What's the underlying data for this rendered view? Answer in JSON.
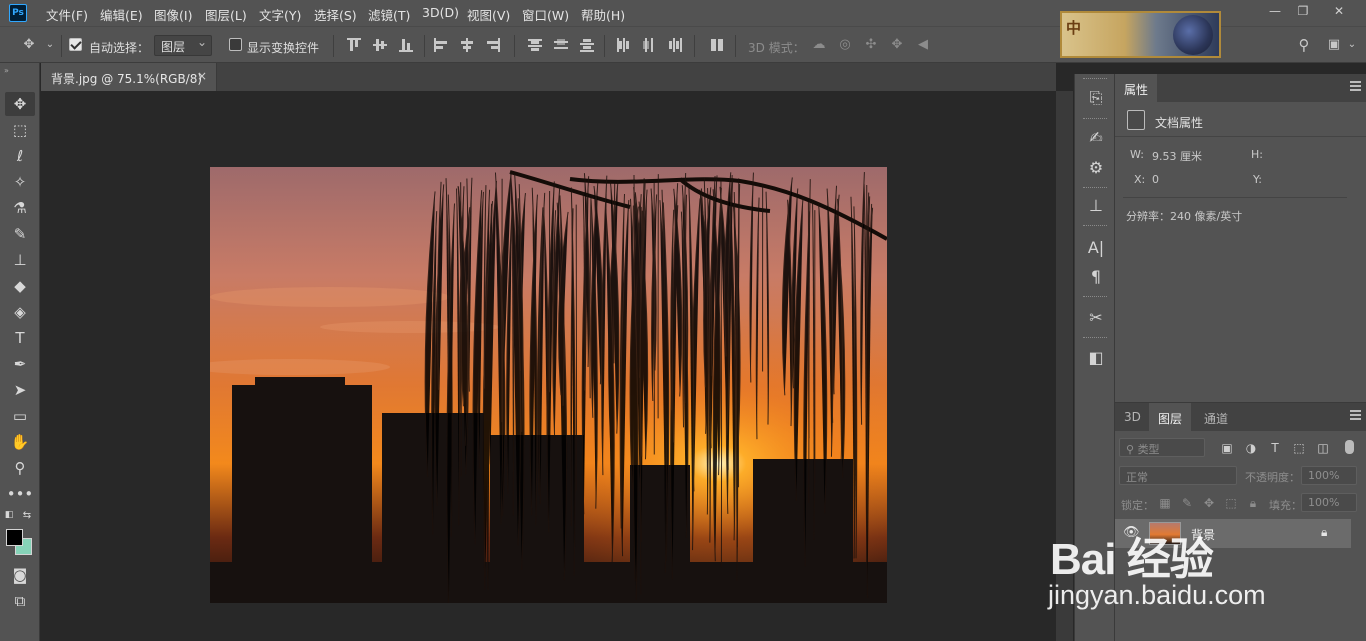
{
  "app": {
    "logo_text": "Ps"
  },
  "menu": [
    "文件(F)",
    "编辑(E)",
    "图像(I)",
    "图层(L)",
    "文字(Y)",
    "选择(S)",
    "滤镜(T)",
    "3D(D)",
    "视图(V)",
    "窗口(W)",
    "帮助(H)"
  ],
  "banner": {
    "text": "中"
  },
  "window_controls": {
    "minimize": "—",
    "restore": "❐",
    "close": "✕"
  },
  "options": {
    "auto_select_label": "自动选择：",
    "auto_select_checked": true,
    "auto_select_target": "图层",
    "show_transform_label": "显示变换控件",
    "show_transform_checked": false,
    "mode_3d_label": "3D 模式："
  },
  "document": {
    "tab_title": "背景.jpg @ 75.1%(RGB/8)",
    "close_glyph": "×"
  },
  "properties_panel": {
    "tab": "属性",
    "section_title": "文档属性",
    "w_label": "W:",
    "w_value": "9.53 厘米",
    "h_label": "H:",
    "x_label": "X:",
    "x_value": "0",
    "y_label": "Y:",
    "resolution": "分辨率：240 像素/英寸"
  },
  "layers_panel": {
    "tabs": [
      "3D",
      "图层",
      "通道"
    ],
    "active_tab": "图层",
    "filter_label": "类型",
    "blend_mode": "正常",
    "opacity_label": "不透明度：",
    "opacity_value": "100%",
    "lock_label": "锁定：",
    "fill_label": "填充：",
    "fill_value": "100%",
    "layers": [
      {
        "name": "背景",
        "visible": true,
        "locked": true
      }
    ]
  },
  "watermark": {
    "brand": "Bai 经验",
    "url": "jingyan.baidu.com"
  },
  "colors": {
    "foreground": "#000000",
    "background": "#86d3b8",
    "ui_bg": "#535353",
    "canvas_bg": "#282828"
  }
}
